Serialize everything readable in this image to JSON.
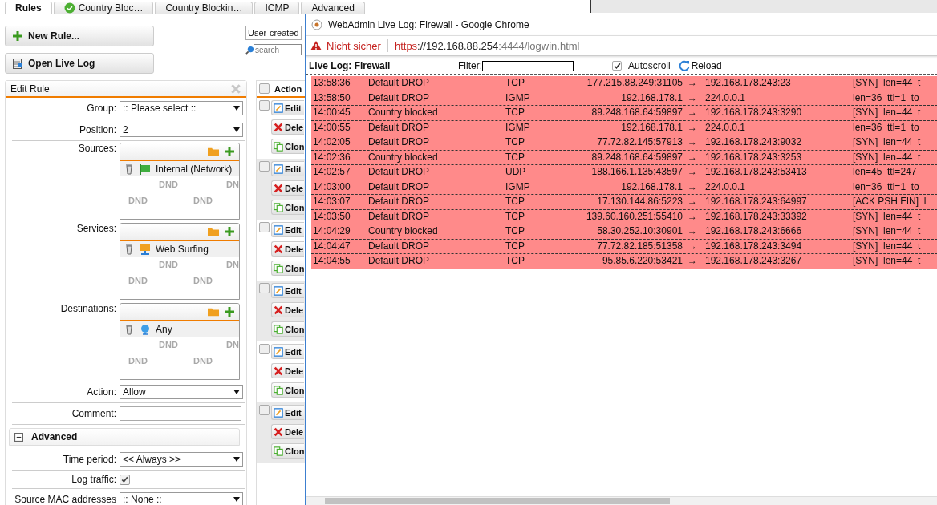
{
  "tabs": [
    {
      "label": "Rules",
      "selected": true,
      "kind": "plain"
    },
    {
      "label": "Country Bloc…",
      "selected": false,
      "kind": "check"
    },
    {
      "label": "Country Blockin…",
      "selected": false,
      "kind": "plain"
    },
    {
      "label": "ICMP",
      "selected": false,
      "kind": "plain"
    },
    {
      "label": "Advanced",
      "selected": false,
      "kind": "plain"
    }
  ],
  "buttons": [
    {
      "label": "New Rule...",
      "kind": "add"
    },
    {
      "label": "Open Live Log",
      "kind": "log"
    }
  ],
  "filter": {
    "value": "User-created",
    "search_placeholder": "search"
  },
  "edit_rule": {
    "title": "Edit Rule",
    "fields": [
      {
        "kind": "select",
        "label": "Group:",
        "value": ":: Please select ::"
      },
      {
        "kind": "select",
        "label": "Position:",
        "value": "2"
      },
      {
        "kind": "list",
        "label": "Sources:",
        "item": {
          "label": "Internal (Network)",
          "kind": "network"
        },
        "watermarks": [
          "DND",
          "DN",
          "DND",
          "DND"
        ]
      },
      {
        "kind": "list",
        "label": "Services:",
        "item": {
          "label": "Web Surfing",
          "kind": "service"
        },
        "watermarks": [
          "DND",
          "DN",
          "DND",
          "DND"
        ]
      },
      {
        "kind": "list",
        "label": "Destinations:",
        "item": {
          "label": "Any",
          "kind": "globe"
        },
        "watermarks": [
          "DND",
          "DN",
          "DND",
          "DND"
        ]
      },
      {
        "kind": "select",
        "label": "Action:",
        "value": "Allow"
      },
      {
        "kind": "text",
        "label": "Comment:"
      },
      {
        "kind": "section",
        "label": "Advanced",
        "expanded": true
      },
      {
        "kind": "select",
        "label": "Time period:",
        "value": "<< Always >>"
      },
      {
        "kind": "checkbox",
        "label": "Log traffic:",
        "checked": true
      },
      {
        "kind": "select",
        "label": "Source MAC addresses",
        "value": ":: None ::"
      }
    ]
  },
  "rules_table": {
    "header": "Action",
    "all_checked": false,
    "groups": [
      {
        "buttons": [
          "Edit",
          "Dele",
          "Clon"
        ],
        "checked": false
      },
      {
        "buttons": [
          "Edit",
          "Dele",
          "Clon"
        ],
        "checked": false
      },
      {
        "buttons": [
          "Edit",
          "Dele",
          "Clon"
        ],
        "checked": false
      },
      {
        "buttons": [
          "Edit",
          "Dele",
          "Clon"
        ],
        "checked": false
      },
      {
        "buttons": [
          "Edit",
          "Dele",
          "Clon"
        ],
        "checked": false
      },
      {
        "buttons": [
          "Edit",
          "Dele",
          "Clon"
        ],
        "checked": false
      }
    ]
  },
  "popup": {
    "title": "WebAdmin Live Log: Firewall - Google Chrome",
    "security": "Nicht sicher",
    "url_scheme": "https",
    "url_host": "://192.168.88.254",
    "url_rest": ":4444/logwin.html",
    "heading": "Live Log: Firewall",
    "filter_label": "Filter:",
    "autoscroll": {
      "label": "Autoscroll",
      "checked": true
    },
    "reload": "Reload",
    "rows": [
      {
        "time": "13:58:36",
        "reason": "Default DROP",
        "protocol": "TCP",
        "source": "177.215.88.249:31105",
        "arrow": "→",
        "destination": "192.168.178.243:23",
        "details": "[SYN]  len=44  t",
        "color": "#ff8a8a"
      },
      {
        "time": "13:58:50",
        "reason": "Default DROP",
        "protocol": "IGMP",
        "source": "192.168.178.1",
        "arrow": "→",
        "destination": "224.0.0.1",
        "details": "len=36  ttl=1  to",
        "color": "#ff8a8a"
      },
      {
        "time": "14:00:45",
        "reason": "Country blocked",
        "protocol": "TCP",
        "source": "89.248.168.64:59897",
        "arrow": "→",
        "destination": "192.168.178.243:3290",
        "details": "[SYN]  len=44  t",
        "color": "#ff8a8a"
      },
      {
        "time": "14:00:55",
        "reason": "Default DROP",
        "protocol": "IGMP",
        "source": "192.168.178.1",
        "arrow": "→",
        "destination": "224.0.0.1",
        "details": "len=36  ttl=1  to",
        "color": "#ff8a8a"
      },
      {
        "time": "14:02:05",
        "reason": "Default DROP",
        "protocol": "TCP",
        "source": "77.72.82.145:57913",
        "arrow": "→",
        "destination": "192.168.178.243:9032",
        "details": "[SYN]  len=44  t",
        "color": "#ff8a8a"
      },
      {
        "time": "14:02:36",
        "reason": "Country blocked",
        "protocol": "TCP",
        "source": "89.248.168.64:59897",
        "arrow": "→",
        "destination": "192.168.178.243:3253",
        "details": "[SYN]  len=44  t",
        "color": "#ff8a8a"
      },
      {
        "time": "14:02:57",
        "reason": "Default DROP",
        "protocol": "UDP",
        "source": "188.166.1.135:43597",
        "arrow": "→",
        "destination": "192.168.178.243:53413",
        "details": "len=45  ttl=247",
        "color": "#ff8a8a"
      },
      {
        "time": "14:03:00",
        "reason": "Default DROP",
        "protocol": "IGMP",
        "source": "192.168.178.1",
        "arrow": "→",
        "destination": "224.0.0.1",
        "details": "len=36  ttl=1  to",
        "color": "#ff8a8a"
      },
      {
        "time": "14:03:07",
        "reason": "Default DROP",
        "protocol": "TCP",
        "source": "17.130.144.86:5223",
        "arrow": "→",
        "destination": "192.168.178.243:64997",
        "details": "[ACK PSH FIN]  l",
        "color": "#ff8a8a"
      },
      {
        "time": "14:03:50",
        "reason": "Default DROP",
        "protocol": "TCP",
        "source": "139.60.160.251:55410",
        "arrow": "→",
        "destination": "192.168.178.243:33392",
        "details": "[SYN]  len=44  t",
        "color": "#ff8a8a"
      },
      {
        "time": "14:04:29",
        "reason": "Country blocked",
        "protocol": "TCP",
        "source": "58.30.252.10:30901",
        "arrow": "→",
        "destination": "192.168.178.243:6666",
        "details": "[SYN]  len=44  t",
        "color": "#ff8a8a"
      },
      {
        "time": "14:04:47",
        "reason": "Default DROP",
        "protocol": "TCP",
        "source": "77.72.82.185:51358",
        "arrow": "→",
        "destination": "192.168.178.243:3494",
        "details": "[SYN]  len=44  t",
        "color": "#ff8a8a"
      },
      {
        "time": "14:04:55",
        "reason": "Default DROP",
        "protocol": "TCP",
        "source": "95.85.6.220:53421",
        "arrow": "→",
        "destination": "192.168.178.243:3267",
        "details": "[SYN]  len=44  t",
        "color": "#ff8a8a"
      }
    ]
  }
}
